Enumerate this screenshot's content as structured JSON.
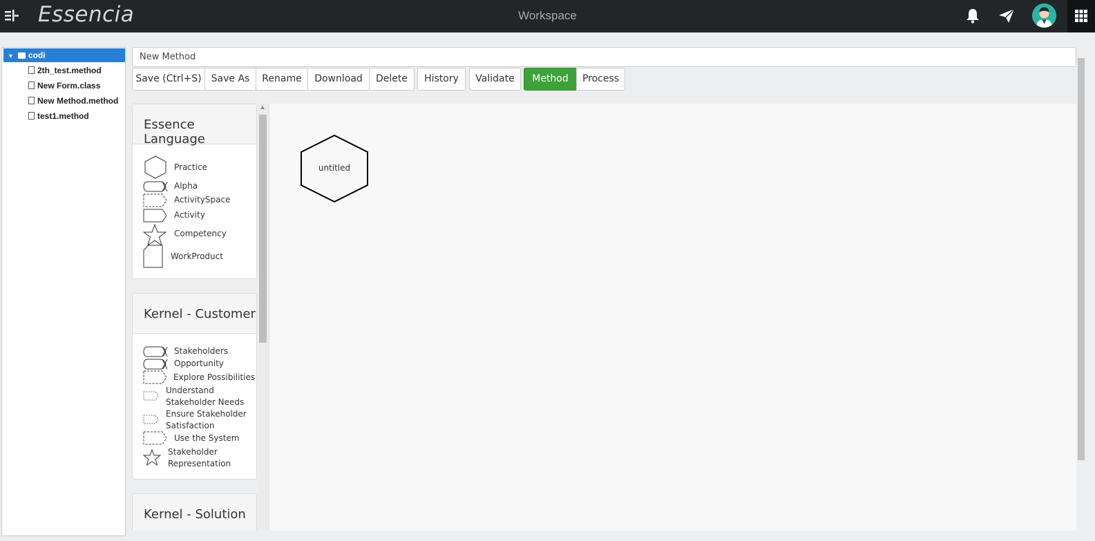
{
  "app": {
    "logo": "Essencia",
    "title": "Workspace"
  },
  "tree": {
    "root": "codi",
    "files": [
      "2th_test.method",
      "New Form.class",
      "New Method.method",
      "test1.method"
    ]
  },
  "editor": {
    "name_value": "New Method"
  },
  "toolbar": {
    "save": "Save (Ctrl+S)",
    "save_as": "Save As",
    "rename": "Rename",
    "download": "Download",
    "delete": "Delete",
    "history": "History",
    "validate": "Validate",
    "method": "Method",
    "process": "Process",
    "active_color": "#3fa13c"
  },
  "palette": {
    "essence": {
      "title": "Essence Language",
      "items": {
        "practice": "Practice",
        "alpha": "Alpha",
        "activity_space": "ActivitySpace",
        "activity": "Activity",
        "competency": "Competency",
        "work_product": "WorkProduct"
      }
    },
    "customer": {
      "title": "Kernel - Customer",
      "items": {
        "stakeholders": "Stakeholders",
        "opportunity": "Opportunity",
        "explore": "Explore Possibilities",
        "understand_1": "Understand",
        "understand_2": "Stakeholder Needs",
        "ensure_1": "Ensure Stakeholder",
        "ensure_2": "Satisfaction",
        "use_system": "Use the System",
        "rep_1": "Stakeholder",
        "rep_2": "Representation"
      }
    },
    "solution": {
      "title": "Kernel - Solution"
    }
  },
  "canvas": {
    "node_label": "untitled"
  }
}
